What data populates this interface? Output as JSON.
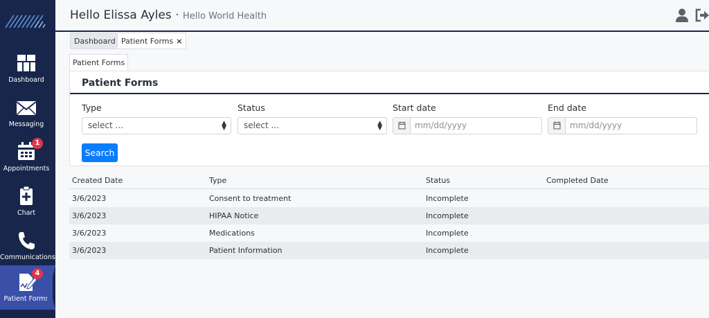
{
  "header": {
    "greeting": "Hello Elissa Ayles",
    "separator": "·",
    "organization": "Hello World Health"
  },
  "sidebar": {
    "items": [
      {
        "label": "Dashboard",
        "icon": "dashboard-icon"
      },
      {
        "label": "Messaging",
        "icon": "envelope-icon"
      },
      {
        "label": "Appointments",
        "icon": "calendar-icon",
        "badge": "1"
      },
      {
        "label": "Chart",
        "icon": "clipboard-plus-icon"
      },
      {
        "label": "Communications",
        "icon": "phone-icon"
      },
      {
        "label": "Patient Forms",
        "icon": "form-edit-icon",
        "badge": "4",
        "active": true
      }
    ]
  },
  "tabs": [
    {
      "label": "Dashboard"
    },
    {
      "label": "Patient Forms",
      "close": "×"
    }
  ],
  "subtab": {
    "label": "Patient Forms"
  },
  "panel": {
    "title": "Patient Forms",
    "filters": {
      "type": {
        "label": "Type",
        "value": "select ..."
      },
      "status": {
        "label": "Status",
        "value": "select ..."
      },
      "start": {
        "label": "Start date",
        "placeholder": "mm/dd/yyyy"
      },
      "end": {
        "label": "End date",
        "placeholder": "mm/dd/yyyy"
      }
    },
    "search_label": "Search"
  },
  "table": {
    "columns": [
      "Created Date",
      "Type",
      "Status",
      "Completed Date"
    ],
    "rows": [
      [
        "3/6/2023",
        "Consent to treatment",
        "Incomplete",
        ""
      ],
      [
        "3/6/2023",
        "HIPAA Notice",
        "Incomplete",
        ""
      ],
      [
        "3/6/2023",
        "Medications",
        "Incomplete",
        ""
      ],
      [
        "3/6/2023",
        "Patient Information",
        "Incomplete",
        ""
      ]
    ]
  },
  "colors": {
    "sidebar_bg": "#17264a",
    "active_item": "#3a4fa8",
    "badge": "#e0364a",
    "primary_button": "#0a7cff"
  }
}
